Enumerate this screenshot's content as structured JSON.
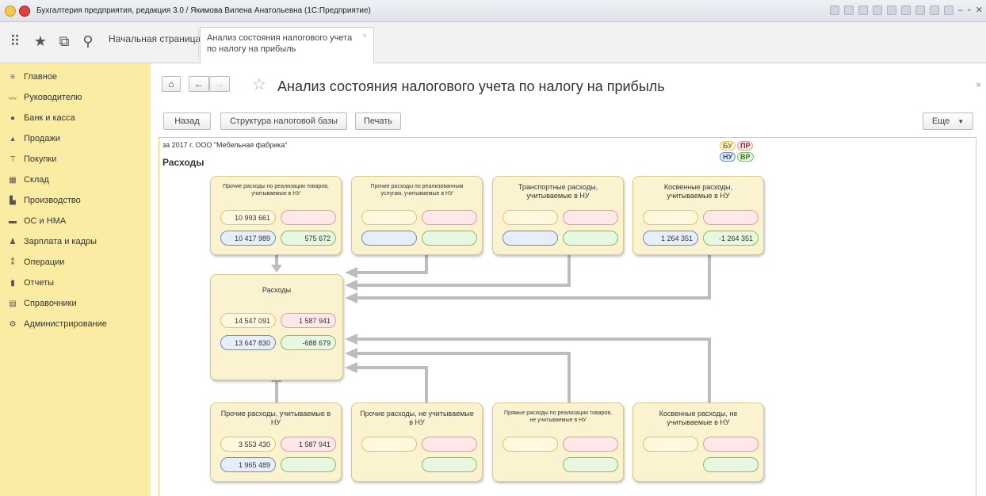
{
  "window": {
    "title": "Бухгалтерия предприятия, редакция 3.0 / Якимова Вилена Анатольевна (1С:Предприятие)"
  },
  "toolbar": {
    "home_tab": "Начальная страница",
    "active_tab_line1": "Анализ состояния налогового учета",
    "active_tab_line2": "по налогу на прибыль",
    "icons": [
      "apps-grid-icon",
      "favorites-star-icon",
      "history-icon",
      "search-icon"
    ]
  },
  "sidebar": {
    "items": [
      {
        "label": "Главное",
        "icon": "menu-icon"
      },
      {
        "label": "Руководителю",
        "icon": "trend-icon"
      },
      {
        "label": "Банк и касса",
        "icon": "bank-icon"
      },
      {
        "label": "Продажи",
        "icon": "sales-icon"
      },
      {
        "label": "Покупки",
        "icon": "cart-icon"
      },
      {
        "label": "Склад",
        "icon": "warehouse-icon"
      },
      {
        "label": "Производство",
        "icon": "factory-icon"
      },
      {
        "label": "ОС и НМА",
        "icon": "truck-icon"
      },
      {
        "label": "Зарплата и кадры",
        "icon": "person-icon"
      },
      {
        "label": "Операции",
        "icon": "operations-icon"
      },
      {
        "label": "Отчеты",
        "icon": "reports-icon"
      },
      {
        "label": "Справочники",
        "icon": "book-icon"
      },
      {
        "label": "Администрирование",
        "icon": "gear-icon"
      }
    ]
  },
  "header": {
    "title": "Анализ состояния налогового учета по налогу на прибыль",
    "close": "×"
  },
  "commands": {
    "back": "Назад",
    "structure": "Структура налоговой базы",
    "print": "Печать",
    "more": "Еще"
  },
  "diagram": {
    "period": "за 2017 г. ООО \"Мебельная фабрика\"",
    "heading": "Расходы",
    "legend": {
      "bu": "БУ",
      "pr": "ПР",
      "nu": "НУ",
      "vr": "ВР"
    },
    "colors": {
      "bu": "#e4c461",
      "pr": "#e79a9a",
      "nu": "#6e8db4",
      "vr": "#7cc35e",
      "card": "#fbf3cf"
    },
    "top_cards": [
      {
        "title": "Прочие расходы по реализации товаров, учитываемые в НУ",
        "bu": "10 993 661",
        "pr": "",
        "nu": "10 417 989",
        "vr": "575 672"
      },
      {
        "title": "Прочие расходы по реализованным услугам, учитываемые в НУ",
        "bu": "",
        "pr": "",
        "nu": "",
        "vr": ""
      },
      {
        "title": "Транспортные расходы, учитываемые в НУ",
        "bu": "",
        "pr": "",
        "nu": "",
        "vr": ""
      },
      {
        "title": "Косвенные расходы, учитываемые в НУ",
        "bu": "",
        "pr": "",
        "nu": "1 264 351",
        "vr": "-1 264 351"
      }
    ],
    "center_card": {
      "title": "Расходы",
      "bu": "14 547 091",
      "pr": "1 587 941",
      "nu": "13 647 830",
      "vr": "-688 679"
    },
    "bottom_cards": [
      {
        "title": "Прочие расходы, учитываемые в НУ",
        "bu": "3 553 430",
        "pr": "1 587 941",
        "nu": "1 965 489",
        "vr": ""
      },
      {
        "title": "Прочие расходы, не учитываемые в НУ",
        "bu": "",
        "pr": "",
        "vr": ""
      },
      {
        "title": "Прямые расходы по реализации товаров, не учитываемые в НУ",
        "bu": "",
        "pr": "",
        "vr": ""
      },
      {
        "title": "Косвенные расходы, не учитываемые в НУ",
        "bu": "",
        "pr": "",
        "vr": ""
      }
    ]
  }
}
